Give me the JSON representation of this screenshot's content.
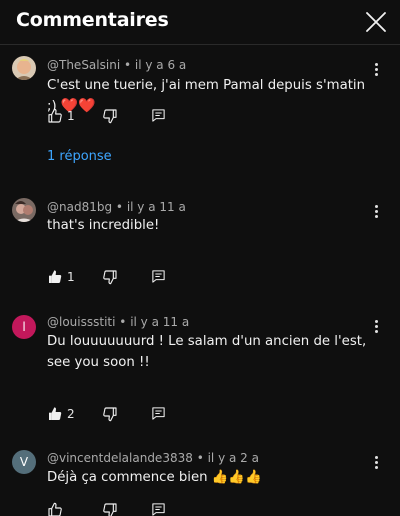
{
  "header": {
    "title": "Commentaires"
  },
  "comments": [
    {
      "author": "@TheSalsini",
      "time": "il y a 6 a",
      "text": "C'est une tuerie, j'ai mem Pamal depuis s'matin ;)",
      "emoji": "❤️❤️",
      "likes": "1",
      "replies": "1 réponse"
    },
    {
      "author": "@nad81bg",
      "time": "il y a 11 a",
      "text": "that's incredible!",
      "likes": "1"
    },
    {
      "author": "@louissstiti",
      "avatar_letter": "l",
      "avatar_color": "#c2185b",
      "time": "il y a 11 a",
      "text": "Du louuuuuuurd ! Le  salam d'un ancien de l'est, see you soon !!",
      "likes": "2"
    },
    {
      "author": "@vincentdelalande3838",
      "avatar_letter": "V",
      "avatar_color": "#546e7a",
      "time": "il y a 2 a",
      "text": "Déjà ça commence bien",
      "emoji": "👍👍👍"
    }
  ],
  "icons": {
    "like": "thumb-up-icon",
    "dislike": "thumb-down-icon",
    "reply": "comment-icon",
    "more": "more-vert-icon",
    "close": "close-icon"
  },
  "colors": {
    "background": "#0f0f0f",
    "link": "#3ea6ff",
    "heart": "#e62117"
  }
}
